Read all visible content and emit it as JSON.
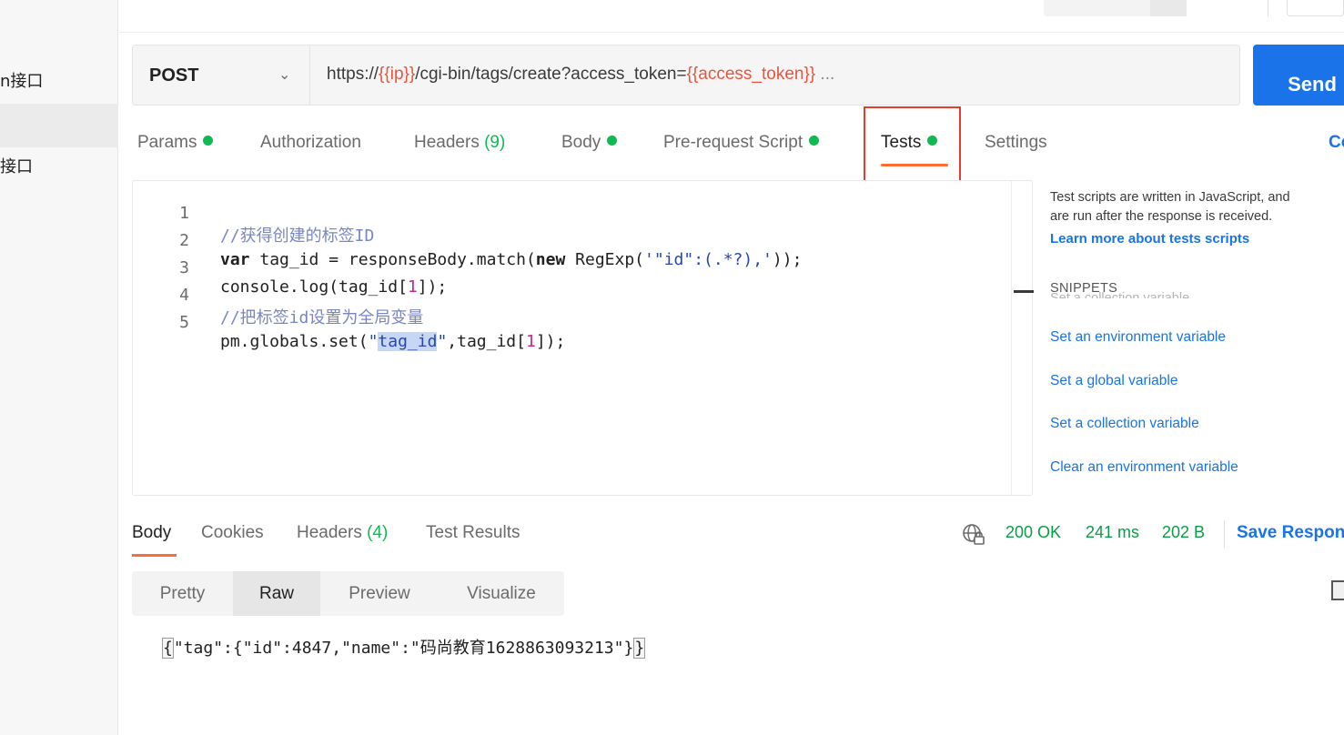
{
  "sidebar": {
    "items": [
      {
        "label": "n接口"
      },
      {
        "label": ""
      },
      {
        "label": "接口"
      }
    ]
  },
  "request": {
    "method": "POST",
    "url_parts": {
      "prefix": "https://",
      "ip_var": "{{ip}}",
      "path": "/cgi-bin/tags/create?access_token=",
      "token_var": "{{access_token}}",
      "suffix": " ..."
    },
    "send_label": "Send"
  },
  "request_tabs": [
    {
      "label": "Params",
      "dot": true
    },
    {
      "label": "Authorization"
    },
    {
      "label": "Headers",
      "count": "(9)"
    },
    {
      "label": "Body",
      "dot": true
    },
    {
      "label": "Pre-request Script",
      "dot": true
    },
    {
      "label": "Tests",
      "dot": true,
      "active": true
    },
    {
      "label": "Settings"
    }
  ],
  "cookies_stub": "Co",
  "editor": {
    "line_numbers": [
      "1",
      "2",
      "3",
      "4",
      "5"
    ],
    "lines": {
      "l1": "//获得创建的标签ID",
      "l2_kw1": "var",
      "l2_a": " tag_id = responseBody.match(",
      "l2_kw2": "new",
      "l2_b": " RegExp(",
      "l2_str": "'\"id\":(.*?),'",
      "l2_c": "));",
      "l3_a": "console.log(tag_id[",
      "l3_num": "1",
      "l3_b": "]);",
      "l4": "//把标签id设置为全局变量",
      "l5_a": "pm.globals.set(",
      "l5_q1": "\"",
      "l5_sel": "tag_id",
      "l5_q2": "\"",
      "l5_b": ",tag_id[",
      "l5_num": "1",
      "l5_c": "]);"
    }
  },
  "snippets": {
    "desc_line1": "Test scripts are written in JavaScript, and",
    "desc_line2": "are run after the response is received.",
    "learn_more": "Learn more about tests scripts",
    "title": "SNIPPETS",
    "ghost": "Set a collection variable",
    "items": [
      "Set an environment variable",
      "Set a global variable",
      "Set a collection variable",
      "Clear an environment variable"
    ]
  },
  "response": {
    "tabs": [
      {
        "label": "Body",
        "active": true
      },
      {
        "label": "Cookies"
      },
      {
        "label": "Headers",
        "count": "(4)"
      },
      {
        "label": "Test Results"
      }
    ],
    "status": "200 OK",
    "time": "241 ms",
    "size": "202 B",
    "save_label": "Save Response",
    "formats": [
      "Pretty",
      "Raw",
      "Preview",
      "Visualize"
    ],
    "active_format": "Raw",
    "body_open": "{",
    "body_text": "\"tag\":{\"id\":4847,\"name\":\"码尚教育1628863093213\"}",
    "body_close": "}"
  }
}
